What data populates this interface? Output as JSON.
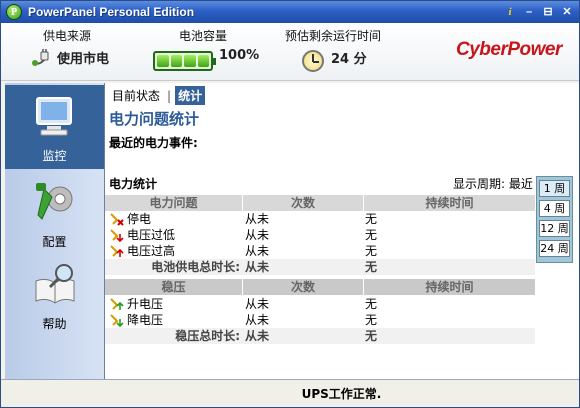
{
  "window": {
    "title": "PowerPanel Personal Edition",
    "app_icon_glyph": "P",
    "buttons": {
      "info": "i",
      "minimize": "–",
      "restore": "⊟",
      "close": "✕"
    }
  },
  "header": {
    "power_source": {
      "label": "供电来源",
      "value": "使用市电",
      "icon": "plug-icon"
    },
    "battery": {
      "label": "电池容量",
      "value": "100%",
      "level": 1.0,
      "icon": "battery-icon"
    },
    "runtime": {
      "label": "预估剩余运行时间",
      "value": "24 分",
      "icon": "clock-icon"
    },
    "brand": "CyberPower"
  },
  "sidebar": {
    "items": [
      {
        "label": "监控",
        "icon": "monitor-icon",
        "selected": true
      },
      {
        "label": "配置",
        "icon": "tools-icon",
        "selected": false
      },
      {
        "label": "帮助",
        "icon": "help-book-icon",
        "selected": false
      }
    ]
  },
  "tabs": [
    {
      "label": "目前状态",
      "active": false
    },
    {
      "label": "统计",
      "active": true
    }
  ],
  "main": {
    "section_title": "电力问题统计",
    "recent_events_label": "最近的电力事件:",
    "stats_label": "电力统计",
    "period_label": "显示周期: 最近",
    "periods": [
      "1 周",
      "4 周",
      "12 周",
      "24 周"
    ]
  },
  "power_table": {
    "headers": [
      "电力问题",
      "次数",
      "持续时间"
    ],
    "rows": [
      {
        "name": "停电",
        "count": "从未",
        "duration": "无",
        "icon": "blackout-icon"
      },
      {
        "name": "电压过低",
        "count": "从未",
        "duration": "无",
        "icon": "undervoltage-icon"
      },
      {
        "name": "电压过高",
        "count": "从未",
        "duration": "无",
        "icon": "overvoltage-icon"
      }
    ],
    "total": {
      "label": "电池供电总时长:",
      "count": "从未",
      "duration": "无"
    }
  },
  "avr_table": {
    "headers": [
      "稳压",
      "次数",
      "持续时间"
    ],
    "rows": [
      {
        "name": "升电压",
        "count": "从未",
        "duration": "无",
        "icon": "boost-icon"
      },
      {
        "name": "降电压",
        "count": "从未",
        "duration": "无",
        "icon": "buck-icon"
      }
    ],
    "total": {
      "label": "稳压总时长:",
      "count": "从未",
      "duration": "无"
    }
  },
  "status": {
    "text": "UPS工作正常."
  },
  "colors": {
    "accent": "#36629a",
    "title_blue": "#2c5a96",
    "brand_red": "#c8151b"
  }
}
